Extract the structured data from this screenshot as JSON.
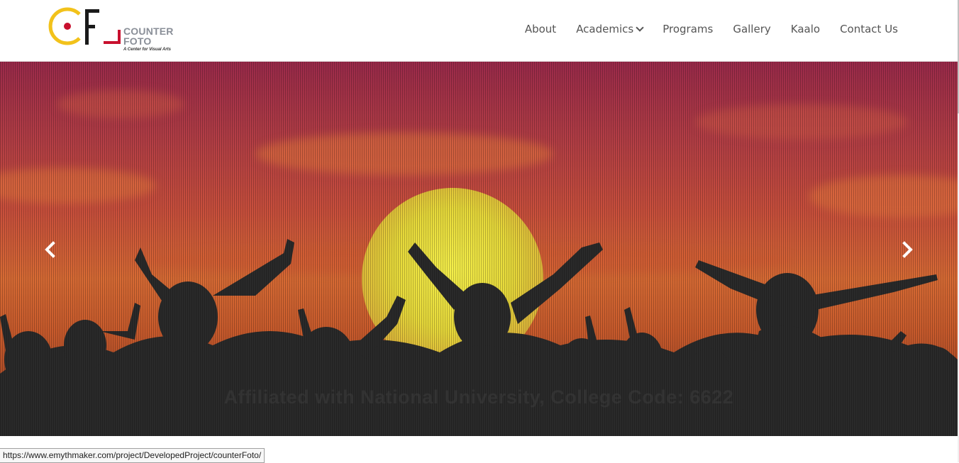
{
  "brand": {
    "logo_letters": "CF",
    "name_line1": "COUNTER",
    "name_line2": "FOTO",
    "tagline": "A Center for Visual Arts",
    "colors": {
      "yellow": "#f2c21b",
      "red": "#c8102e",
      "black": "#1a1a1a",
      "gray_text": "#8a8f98"
    }
  },
  "nav": {
    "items": [
      {
        "label": "About",
        "has_dropdown": false
      },
      {
        "label": "Academics",
        "has_dropdown": true
      },
      {
        "label": "Programs",
        "has_dropdown": false
      },
      {
        "label": "Gallery",
        "has_dropdown": false
      },
      {
        "label": "Kaalo",
        "has_dropdown": false
      },
      {
        "label": "Contact Us",
        "has_dropdown": false
      }
    ]
  },
  "hero": {
    "caption": "Affiliated with National University, College Code: 6622",
    "prev_icon": "chevron-left-icon",
    "next_icon": "chevron-right-icon"
  },
  "status_bar": {
    "url": "https://www.emythmaker.com/project/DevelopedProject/counterFoto/"
  }
}
